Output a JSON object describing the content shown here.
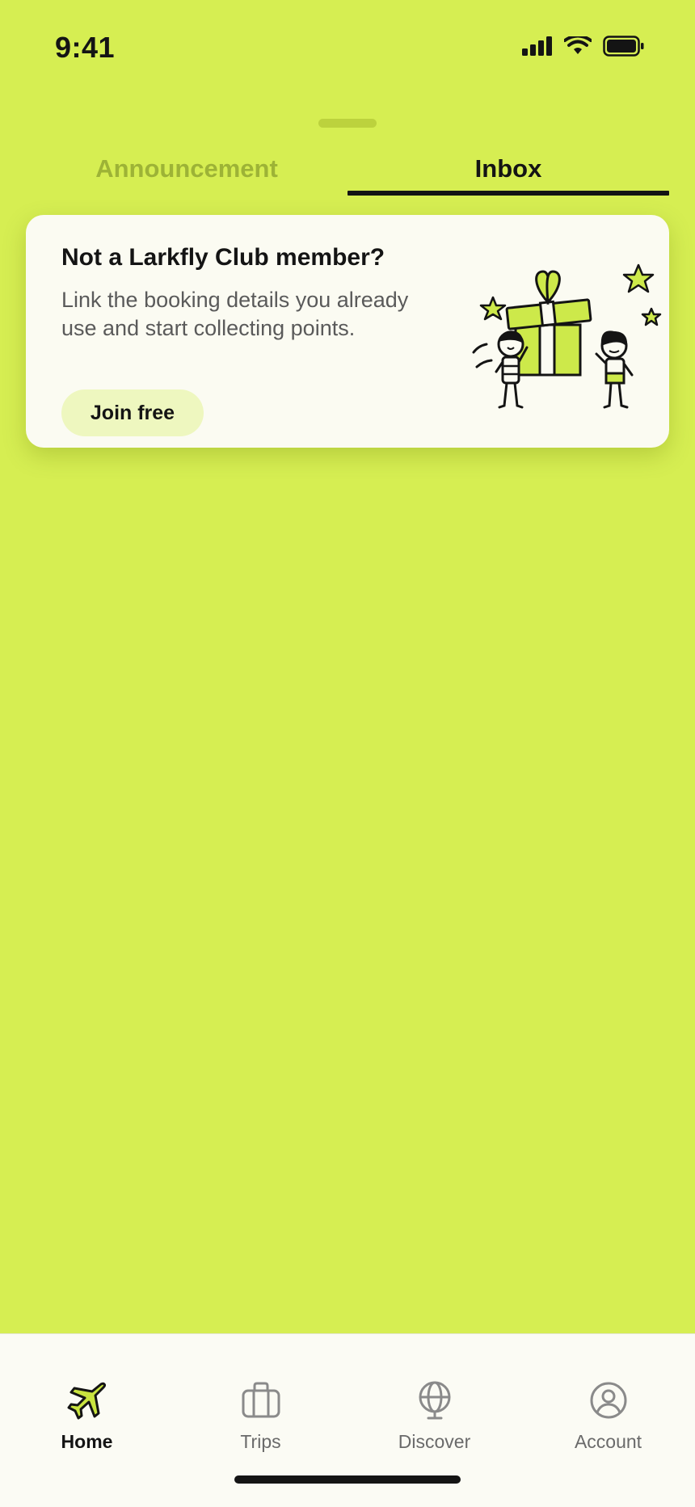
{
  "status_bar": {
    "time": "9:41",
    "icons": [
      "signal-icon",
      "wifi-icon",
      "battery-icon"
    ]
  },
  "tabs": [
    {
      "label": "Announcement",
      "active": false
    },
    {
      "label": "Inbox",
      "active": true
    }
  ],
  "promo_card": {
    "title": "Not a Larkfly Club member?",
    "body": "Link the booking details you already use and start collecting points.",
    "button_label": "Join free",
    "illustration": "gift-illustration"
  },
  "bottom_nav": {
    "items": [
      {
        "label": "Home",
        "icon": "airplane-icon",
        "active": true
      },
      {
        "label": "Trips",
        "icon": "suitcase-icon",
        "active": false
      },
      {
        "label": "Discover",
        "icon": "globe-icon",
        "active": false
      },
      {
        "label": "Account",
        "icon": "user-circle-icon",
        "active": false
      }
    ]
  },
  "colors": {
    "background": "#d6ee52",
    "card": "#fbfbf2",
    "accent_button": "#eef7bf",
    "text_primary": "#141414",
    "tab_inactive": "#9db336"
  }
}
